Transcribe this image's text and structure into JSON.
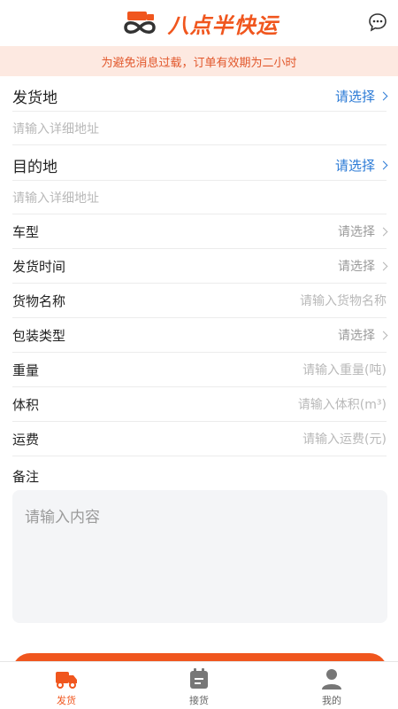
{
  "header": {
    "brand": "八点半快运",
    "chat_icon": "chat-bubble-icon"
  },
  "notice": "为避免消息过载，订单有效期为二小时",
  "origin": {
    "label": "发货地",
    "select": "请选择",
    "address_placeholder": "请输入详细地址"
  },
  "destination": {
    "label": "目的地",
    "select": "请选择",
    "address_placeholder": "请输入详细地址"
  },
  "fields": [
    {
      "label": "车型",
      "value": "请选择",
      "kind": "select"
    },
    {
      "label": "发货时间",
      "value": "请选择",
      "kind": "select"
    },
    {
      "label": "货物名称",
      "value": "请输入货物名称",
      "kind": "input"
    },
    {
      "label": "包装类型",
      "value": "请选择",
      "kind": "select"
    },
    {
      "label": "重量",
      "value": "请输入重量(吨)",
      "kind": "input"
    },
    {
      "label": "体积",
      "value": "请输入体积(m³)",
      "kind": "input"
    },
    {
      "label": "运费",
      "value": "请输入运费(元)",
      "kind": "input"
    }
  ],
  "note": {
    "label": "备注",
    "placeholder": "请输入内容"
  },
  "tabs": [
    {
      "label": "发货",
      "icon": "truck-icon",
      "active": true
    },
    {
      "label": "接货",
      "icon": "clipboard-icon",
      "active": false
    },
    {
      "label": "我的",
      "icon": "user-icon",
      "active": false
    }
  ],
  "colors": {
    "brand": "#f0561e",
    "link": "#2c7bd6",
    "notice_bg": "#fde9e1"
  }
}
